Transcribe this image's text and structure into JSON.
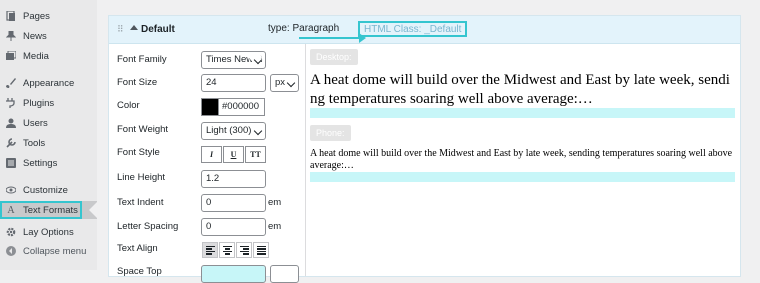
{
  "sidebar": {
    "items": [
      {
        "label": "Pages",
        "icon": "pages-icon"
      },
      {
        "label": "News",
        "icon": "pin-icon"
      },
      {
        "label": "Media",
        "icon": "media-icon"
      },
      {
        "label": "Appearance",
        "icon": "brush-icon"
      },
      {
        "label": "Plugins",
        "icon": "plug-icon"
      },
      {
        "label": "Users",
        "icon": "users-icon"
      },
      {
        "label": "Tools",
        "icon": "wrench-icon"
      },
      {
        "label": "Settings",
        "icon": "settings-icon"
      },
      {
        "label": "Customize",
        "icon": "eye-icon"
      },
      {
        "label": "Text Formats",
        "icon": "text-format-icon",
        "active": true
      },
      {
        "label": "Lay Options",
        "icon": "gear-icon"
      },
      {
        "label": "Collapse menu",
        "icon": "collapse-icon"
      }
    ]
  },
  "panel": {
    "drag": "⠿",
    "title": "Default",
    "type_label": "type: Paragraph",
    "html_class": "HTML Class: _Default"
  },
  "form": {
    "font_family_label": "Font Family",
    "font_family_value": "Times New R",
    "font_size_label": "Font Size",
    "font_size_value": "24",
    "font_size_unit": "px",
    "color_label": "Color",
    "color_value": "#000000",
    "font_weight_label": "Font Weight",
    "font_weight_value": "Light (300)",
    "font_style_label": "Font Style",
    "style_buttons": [
      "I",
      "U",
      "TT"
    ],
    "line_height_label": "Line Height",
    "line_height_value": "1.2",
    "text_indent_label": "Text Indent",
    "text_indent_value": "0",
    "text_indent_unit": "em",
    "letter_spacing_label": "Letter Spacing",
    "letter_spacing_value": "0",
    "letter_spacing_unit": "em",
    "text_align_label": "Text Align",
    "space_top_label": "Space Top"
  },
  "preview": {
    "desktop_label": "Desktop:",
    "desktop_text": "A heat dome will build over the Midwest and East by late week, sending temperatures soaring well above average:…",
    "phone_label": "Phone:",
    "phone_text": "A heat dome will build over the Midwest and East by late week, sending temperatures soaring well above average:…"
  },
  "colors": {
    "accent": "#35c5cf",
    "highlight": "#c7f6f8",
    "header_bg": "#e3f3fb"
  }
}
